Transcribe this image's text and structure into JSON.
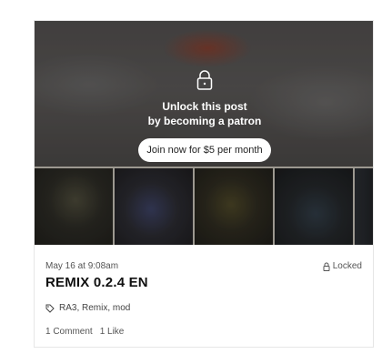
{
  "post": {
    "unlock_line1": "Unlock this post",
    "unlock_line2": "by becoming a patron",
    "join_label": "Join now for $5 per month",
    "date": "May 16 at 9:08am",
    "locked_label": "Locked",
    "title": "REMIX 0.2.4 EN",
    "tags": "RA3, Remix, mod",
    "comments": "1 Comment",
    "likes": "1 Like"
  },
  "icons": {
    "lock": "lock-icon",
    "small_lock": "lock-icon",
    "tag": "tag-icon"
  },
  "colors": {
    "button_bg": "#ffffff",
    "text_primary": "#111111",
    "text_secondary": "#555555"
  }
}
